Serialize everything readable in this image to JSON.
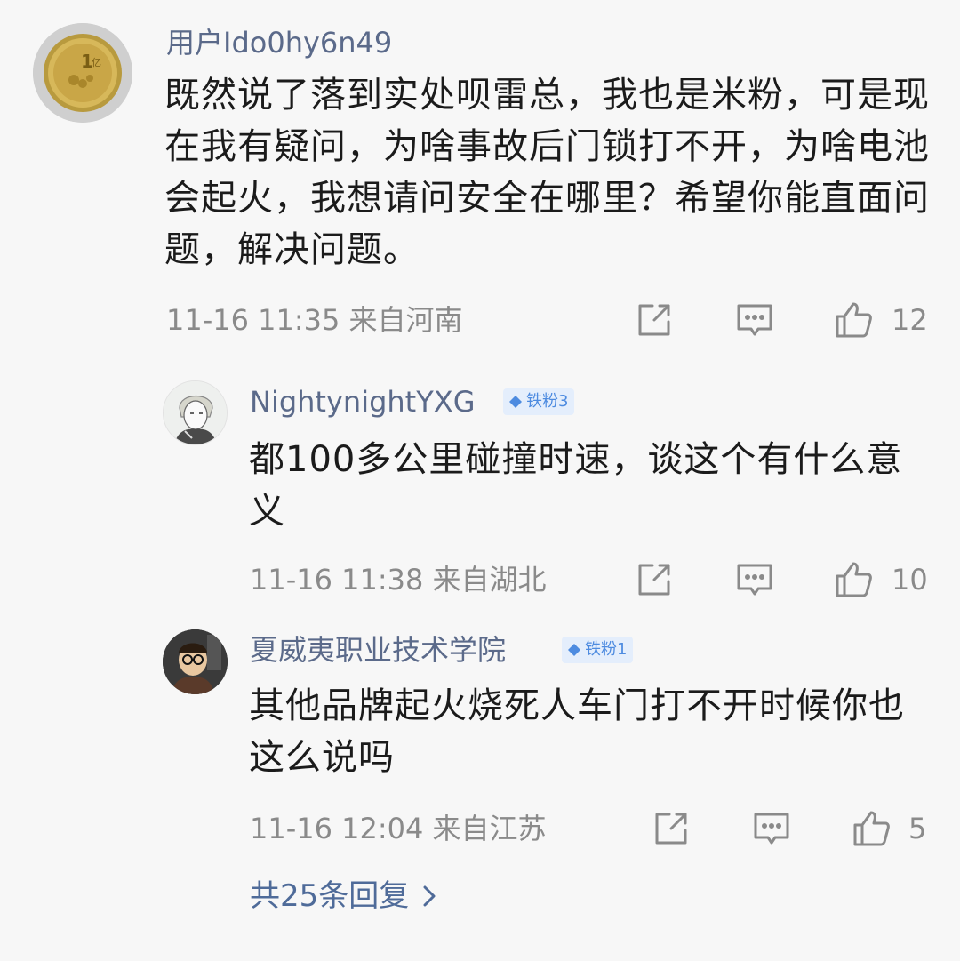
{
  "main_comment": {
    "username": "用户Ido0hy6n49",
    "text": "既然说了落到实处呗雷总，我也是米粉，可是现在我有疑问，为啥事故后门锁打不开，为啥电池会起火，我想请问安全在哪里？希望你能直面问题，解决问题。",
    "timestamp": "11-16 11:35 来自河南",
    "like_count": "12",
    "avatar_icon": "coin-avatar"
  },
  "replies": [
    {
      "username": "NightynightYXG",
      "badge": "铁粉3",
      "text": "都100多公里碰撞时速，谈这个有什么意义",
      "timestamp": "11-16 11:38 来自湖北",
      "like_count": "10",
      "avatar_icon": "anime-portrait-avatar"
    },
    {
      "username": "夏威夷职业技术学院",
      "badge": "铁粉1",
      "text": "其他品牌起火烧死人车门打不开时候你也这么说吗",
      "timestamp": "11-16 12:04 来自江苏",
      "like_count": "5",
      "avatar_icon": "cartoon-glasses-avatar"
    }
  ],
  "more_replies": "共25条回复",
  "colors": {
    "username": "#5b6a8a",
    "text": "#1b1b1b",
    "meta": "#8a8a8a",
    "badge_bg": "#e4eefc",
    "badge_fg": "#4d8be0",
    "link": "#4f6b99"
  },
  "icons": {
    "share": "share-icon",
    "comment": "comment-icon",
    "like": "like-icon",
    "badge": "diamond-icon",
    "chevron": "chevron-right-icon"
  }
}
